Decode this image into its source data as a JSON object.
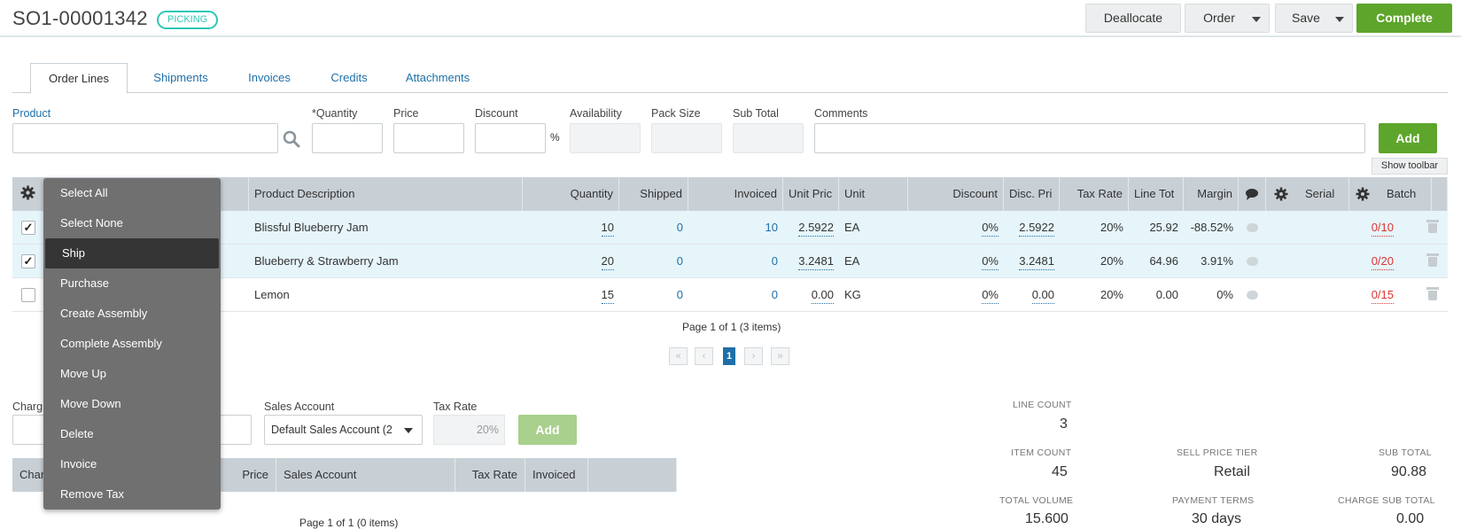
{
  "order": {
    "number": "SO1-00001342",
    "status": "PICKING"
  },
  "header_buttons": {
    "deallocate": "Deallocate",
    "order": "Order",
    "save": "Save",
    "complete": "Complete"
  },
  "tabs": [
    {
      "label": "Order Lines",
      "active": true
    },
    {
      "label": "Shipments"
    },
    {
      "label": "Invoices"
    },
    {
      "label": "Credits"
    },
    {
      "label": "Attachments"
    }
  ],
  "entry": {
    "product": "Product",
    "quantity": "*Quantity",
    "price": "Price",
    "discount": "Discount",
    "percent": "%",
    "availability": "Availability",
    "pack_size": "Pack Size",
    "sub_total": "Sub Total",
    "comments": "Comments",
    "add": "Add",
    "show_toolbar": "Show toolbar"
  },
  "grid": {
    "columns": [
      "Product Description",
      "Quantity",
      "Shipped",
      "Invoiced",
      "Unit Pric",
      "Unit",
      "Discount",
      "Disc. Pri",
      "Tax Rate",
      "Line Tot",
      "Margin",
      "Serial",
      "Batch"
    ],
    "rows": [
      {
        "checked": true,
        "description": "Blissful Blueberry Jam",
        "quantity": "10",
        "shipped": "0",
        "invoiced": "10",
        "unit_price": "2.5922",
        "unit": "EA",
        "discount": "0%",
        "disc_price": "2.5922",
        "tax_rate": "20%",
        "line_total": "25.92",
        "margin": "-88.52%",
        "batch": "0/10"
      },
      {
        "checked": true,
        "description": "Blueberry & Strawberry Jam",
        "quantity": "20",
        "shipped": "0",
        "invoiced": "0",
        "unit_price": "3.2481",
        "unit": "EA",
        "discount": "0%",
        "disc_price": "3.2481",
        "tax_rate": "20%",
        "line_total": "64.96",
        "margin": "3.91%",
        "batch": "0/20"
      },
      {
        "checked": false,
        "description": "Lemon",
        "quantity": "15",
        "shipped": "0",
        "invoiced": "0",
        "unit_price": "0.00",
        "unit": "KG",
        "discount": "0%",
        "disc_price": "0.00",
        "tax_rate": "20%",
        "line_total": "0.00",
        "margin": "0%",
        "batch": "0/15"
      }
    ],
    "pager": {
      "text": "Page 1 of 1 (3 items)",
      "current": "1",
      "first": "«",
      "prev": "‹",
      "next": "›",
      "last": "»"
    }
  },
  "context_menu": {
    "items": [
      "Select All",
      "Select None",
      "Ship",
      "Purchase",
      "Create Assembly",
      "Complete Assembly",
      "Move Up",
      "Move Down",
      "Delete",
      "Invoice",
      "Remove Tax"
    ],
    "highlighted": "Ship"
  },
  "charges": {
    "charge_label": "Charg",
    "sales_account_label": "Sales Account",
    "sales_account_value": "Default Sales Account (2",
    "tax_rate_label": "Tax Rate",
    "tax_rate_value": "20%",
    "add": "Add",
    "columns": [
      "Char",
      "Price",
      "Sales Account",
      "Tax Rate",
      "Invoiced"
    ],
    "pager_partial": "Page 1 of 1 (0 items)"
  },
  "summary": {
    "line_count_label": "LINE COUNT",
    "line_count": "3",
    "item_count_label": "ITEM COUNT",
    "item_count": "45",
    "total_volume_label": "TOTAL VOLUME",
    "total_volume": "15.600",
    "sell_price_tier_label": "SELL PRICE TIER",
    "sell_price_tier": "Retail",
    "payment_terms_label": "PAYMENT TERMS",
    "payment_terms": "30 days",
    "sub_total_label": "SUB TOTAL",
    "sub_total": "90.88",
    "charge_sub_total_label": "CHARGE SUB TOTAL",
    "charge_sub_total": "0.00"
  },
  "colors": {
    "accent_green": "#5da52b",
    "link_blue": "#1e6fa8",
    "status_teal": "#2ec7b6",
    "header_gray": "#c8d0d6",
    "menu_gray": "#707070"
  }
}
